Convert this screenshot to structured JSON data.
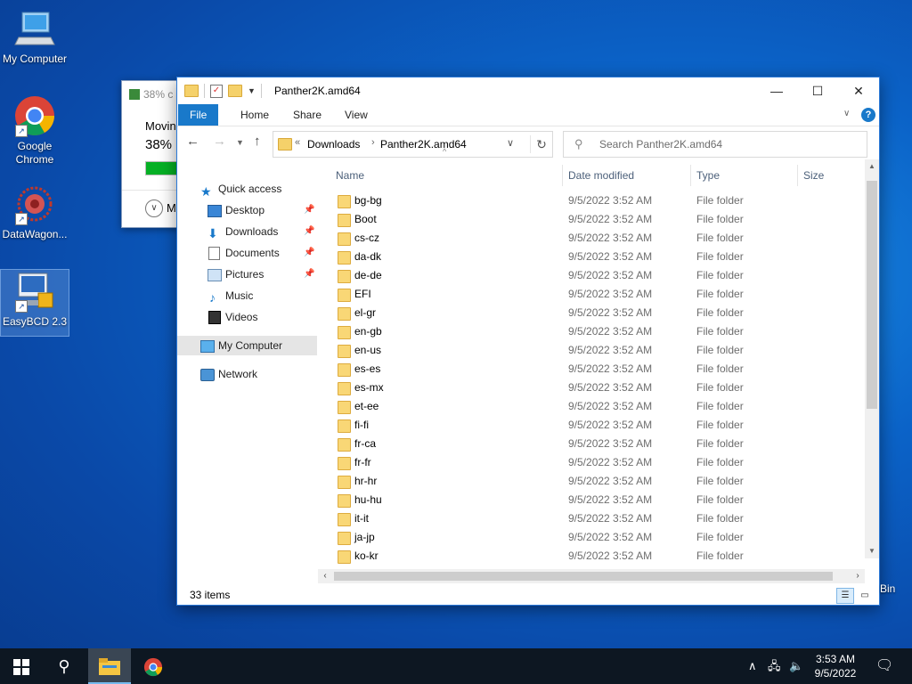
{
  "desktop": {
    "icons": [
      {
        "label": "My Computer"
      },
      {
        "label": "Google Chrome"
      },
      {
        "label": "DataWagon..."
      },
      {
        "label": "EasyBCD 2.3"
      }
    ],
    "recycle_bin_label": "Bin"
  },
  "copy_dialog": {
    "title": "38% c",
    "moving_text": "Moving",
    "percent_text": "38%",
    "progress": 0.38,
    "more_details": "M"
  },
  "explorer": {
    "title": "Panther2K.amd64",
    "ribbon_tabs": [
      "File",
      "Home",
      "Share",
      "View"
    ],
    "address": {
      "segments": [
        "Downloads",
        "Panther2K.amd64"
      ],
      "overflow": "«"
    },
    "search_placeholder": "Search Panther2K.amd64",
    "nav_pane": [
      {
        "label": "Quick access",
        "icon": "star-icon",
        "pinned": false
      },
      {
        "label": "Desktop",
        "icon": "desktop-icon",
        "pinned": true
      },
      {
        "label": "Downloads",
        "icon": "download-icon",
        "pinned": true
      },
      {
        "label": "Documents",
        "icon": "documents-icon",
        "pinned": true
      },
      {
        "label": "Pictures",
        "icon": "pictures-icon",
        "pinned": true
      },
      {
        "label": "Music",
        "icon": "music-icon",
        "pinned": false
      },
      {
        "label": "Videos",
        "icon": "videos-icon",
        "pinned": false
      },
      {
        "label": "My Computer",
        "icon": "computer-icon",
        "pinned": false
      },
      {
        "label": "Network",
        "icon": "network-icon",
        "pinned": false
      }
    ],
    "columns": [
      "Name",
      "Date modified",
      "Type",
      "Size"
    ],
    "files": [
      {
        "name": "bg-bg",
        "date": "9/5/2022 3:52 AM",
        "type": "File folder"
      },
      {
        "name": "Boot",
        "date": "9/5/2022 3:52 AM",
        "type": "File folder"
      },
      {
        "name": "cs-cz",
        "date": "9/5/2022 3:52 AM",
        "type": "File folder"
      },
      {
        "name": "da-dk",
        "date": "9/5/2022 3:52 AM",
        "type": "File folder"
      },
      {
        "name": "de-de",
        "date": "9/5/2022 3:52 AM",
        "type": "File folder"
      },
      {
        "name": "EFI",
        "date": "9/5/2022 3:52 AM",
        "type": "File folder"
      },
      {
        "name": "el-gr",
        "date": "9/5/2022 3:52 AM",
        "type": "File folder"
      },
      {
        "name": "en-gb",
        "date": "9/5/2022 3:52 AM",
        "type": "File folder"
      },
      {
        "name": "en-us",
        "date": "9/5/2022 3:52 AM",
        "type": "File folder"
      },
      {
        "name": "es-es",
        "date": "9/5/2022 3:52 AM",
        "type": "File folder"
      },
      {
        "name": "es-mx",
        "date": "9/5/2022 3:52 AM",
        "type": "File folder"
      },
      {
        "name": "et-ee",
        "date": "9/5/2022 3:52 AM",
        "type": "File folder"
      },
      {
        "name": "fi-fi",
        "date": "9/5/2022 3:52 AM",
        "type": "File folder"
      },
      {
        "name": "fr-ca",
        "date": "9/5/2022 3:52 AM",
        "type": "File folder"
      },
      {
        "name": "fr-fr",
        "date": "9/5/2022 3:52 AM",
        "type": "File folder"
      },
      {
        "name": "hr-hr",
        "date": "9/5/2022 3:52 AM",
        "type": "File folder"
      },
      {
        "name": "hu-hu",
        "date": "9/5/2022 3:52 AM",
        "type": "File folder"
      },
      {
        "name": "it-it",
        "date": "9/5/2022 3:52 AM",
        "type": "File folder"
      },
      {
        "name": "ja-jp",
        "date": "9/5/2022 3:52 AM",
        "type": "File folder"
      },
      {
        "name": "ko-kr",
        "date": "9/5/2022 3:52 AM",
        "type": "File folder"
      }
    ],
    "status_text": "33 items"
  },
  "taskbar": {
    "time": "3:53 AM",
    "date": "9/5/2022"
  },
  "colors": {
    "accent": "#1979ca",
    "progress_green": "#06b025",
    "folder_yellow": "#f9d776"
  }
}
